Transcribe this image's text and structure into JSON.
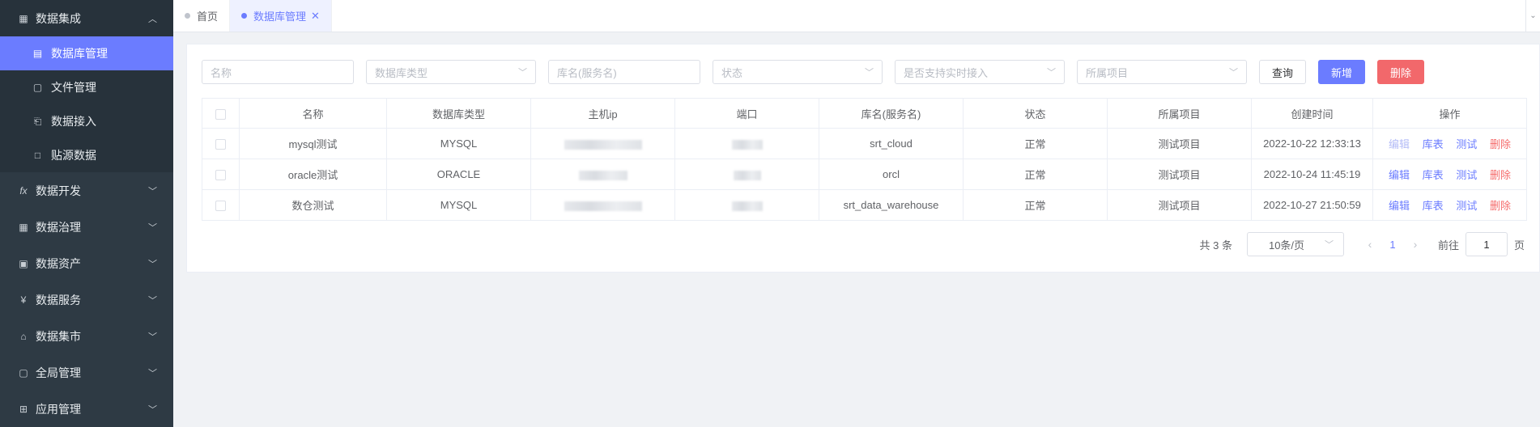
{
  "sidebar": {
    "items": [
      {
        "label": "数据集成",
        "icon": "grid-box-icon",
        "open": true,
        "children": [
          {
            "label": "数据库管理",
            "icon": "database-icon",
            "active": true
          },
          {
            "label": "文件管理",
            "icon": "file-icon"
          },
          {
            "label": "数据接入",
            "icon": "import-icon"
          },
          {
            "label": "贴源数据",
            "icon": "square-icon"
          }
        ]
      },
      {
        "label": "数据开发",
        "icon": "fx-icon"
      },
      {
        "label": "数据治理",
        "icon": "table-icon"
      },
      {
        "label": "数据资产",
        "icon": "terminal-icon"
      },
      {
        "label": "数据服务",
        "icon": "yen-circle-icon"
      },
      {
        "label": "数据集市",
        "icon": "store-icon"
      },
      {
        "label": "全局管理",
        "icon": "panel-icon"
      },
      {
        "label": "应用管理",
        "icon": "apps-icon"
      }
    ]
  },
  "tabs": [
    {
      "label": "首页",
      "active": false
    },
    {
      "label": "数据库管理",
      "active": true,
      "close": "✕"
    }
  ],
  "filters": {
    "name_placeholder": "名称",
    "db_type_placeholder": "数据库类型",
    "schema_placeholder": "库名(服务名)",
    "status_placeholder": "状态",
    "realtime_placeholder": "是否支持实时接入",
    "project_placeholder": "所属项目"
  },
  "buttons": {
    "query": "查询",
    "add": "新增",
    "delete": "删除"
  },
  "table": {
    "headers": [
      "名称",
      "数据库类型",
      "主机ip",
      "端口",
      "库名(服务名)",
      "状态",
      "所属项目",
      "创建时间",
      "操作"
    ],
    "rows": [
      {
        "name": "mysql测试",
        "type": "MYSQL",
        "schema": "srt_cloud",
        "status": "正常",
        "project": "测试项目",
        "created": "2022-10-22 12:33:13"
      },
      {
        "name": "oracle测试",
        "type": "ORACLE",
        "schema": "orcl",
        "status": "正常",
        "project": "测试项目",
        "created": "2022-10-24 11:45:19"
      },
      {
        "name": "数仓测试",
        "type": "MYSQL",
        "schema": "srt_data_warehouse",
        "status": "正常",
        "project": "测试项目",
        "created": "2022-10-27 21:50:59"
      }
    ],
    "actions": {
      "edit": "编辑",
      "tables": "库表",
      "test": "测试",
      "delete": "删除"
    }
  },
  "pagination": {
    "total": "共 3 条",
    "page_size": "10条/页",
    "current": "1",
    "goto_label": "前往",
    "goto_value": "1",
    "suffix": "页"
  }
}
